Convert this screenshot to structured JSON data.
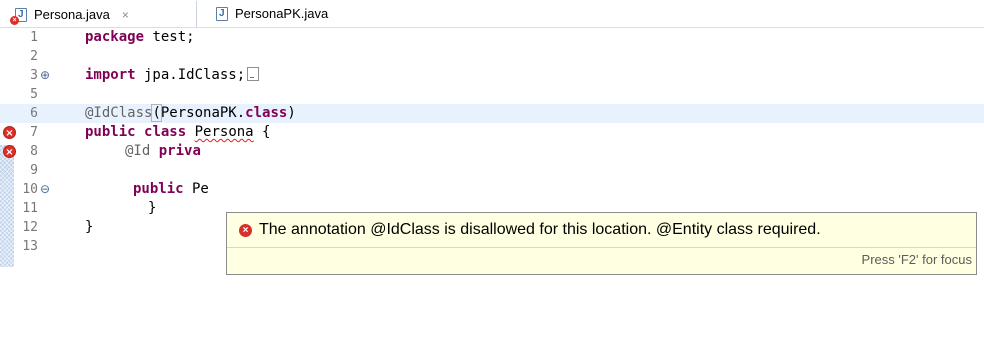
{
  "tabs": [
    {
      "label": "Persona.java",
      "close_icon": "×",
      "active": true
    },
    {
      "label": "PersonaPK.java",
      "active": false
    }
  ],
  "editor": {
    "lines": [
      {
        "n": "1",
        "text": "package test;"
      },
      {
        "n": "2",
        "text": ""
      },
      {
        "n": "3",
        "text": "import jpa.IdClass;"
      },
      {
        "n": "5",
        "text": ""
      },
      {
        "n": "6",
        "text": "@IdClass(PersonaPK.class)"
      },
      {
        "n": "7",
        "text": "public class Persona {"
      },
      {
        "n": "8",
        "text": "@Id private"
      },
      {
        "n": "9",
        "text": ""
      },
      {
        "n": "10",
        "text": "public Pe"
      },
      {
        "n": "11",
        "text": "}"
      },
      {
        "n": "12",
        "text": "}"
      },
      {
        "n": "13",
        "text": ""
      }
    ],
    "tokens": {
      "package_kw": "package",
      "package_name": " test;",
      "import_kw": "import",
      "import_name": " jpa.IdClass;",
      "annotation": "@IdClass",
      "paren_open": "(",
      "annotation_arg": "PersonaPK.",
      "class_kw_1": "class",
      "paren_close": ")",
      "public_kw": "public",
      "class_kw_2": "class",
      "class_name": "Persona",
      "open_brace": " {",
      "id_annotation": "@Id",
      "private_kw": "priva",
      "ctor_public_kw": "public",
      "ctor_name": " Pe",
      "ctor_rest": "(){",
      "close_brace_inner": "}",
      "close_brace_outer": "}"
    }
  },
  "hover": {
    "message": "The annotation @IdClass is disallowed for this location. @Entity class required.",
    "footer": "Press 'F2' for focus"
  },
  "colors": {
    "keyword": "#7f0055",
    "annotation": "#646464",
    "error": "#d9312a",
    "current_line": "#e8f2fe",
    "hover_bg": "#ffffe1"
  }
}
